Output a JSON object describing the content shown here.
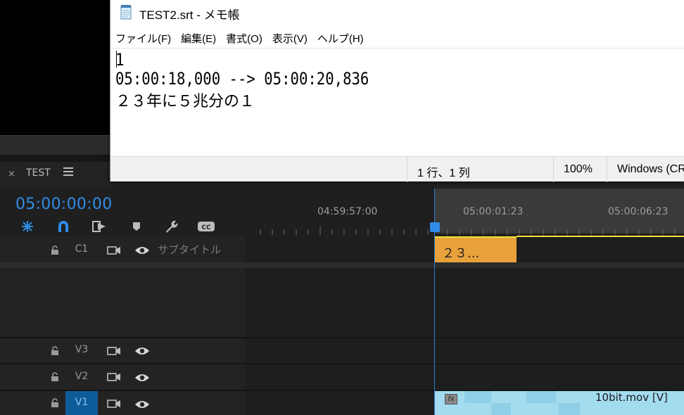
{
  "notepad": {
    "title": "TEST2.srt - メモ帳",
    "menu": [
      "ファイル(F)",
      "編集(E)",
      "書式(O)",
      "表示(V)",
      "ヘルプ(H)"
    ],
    "lines": [
      "1",
      "05:00:18,000 --> 05:00:20,836",
      "２３年に５兆分の１"
    ],
    "status": {
      "position": "1 行、1 列",
      "zoom": "100%",
      "encoding": "Windows (CR"
    }
  },
  "timeline": {
    "sequence_name": "TEST",
    "close_symbol": "×",
    "timecode": "05:00:00:00",
    "ruler_labels": [
      "04:59:57:00",
      "05:00:01:23",
      "05:00:06:23"
    ],
    "tracks": {
      "c1": {
        "name": "C1",
        "label": "サブタイトル"
      },
      "v3": {
        "name": "V3"
      },
      "v2": {
        "name": "V2"
      },
      "v1": {
        "name": "V1"
      }
    },
    "subtitle_clip": "２３...",
    "video_clip": "10bit.mov [V]",
    "fx_label": "fx"
  },
  "icons": [
    "close-icon",
    "hamburger-menu-icon",
    "ripple-insert-icon",
    "snap-magnet-icon",
    "linked-selection-icon",
    "add-marker-icon",
    "wrench-icon",
    "captions-icon",
    "lock-icon",
    "camera-toggle-icon",
    "eye-icon",
    "notepad-icon"
  ],
  "colors": {
    "accent": "#2f8ce6",
    "subtitle_clip": "#e9a23b",
    "video_clip": "#a3dcef",
    "active_track": "#0e5b9a"
  }
}
